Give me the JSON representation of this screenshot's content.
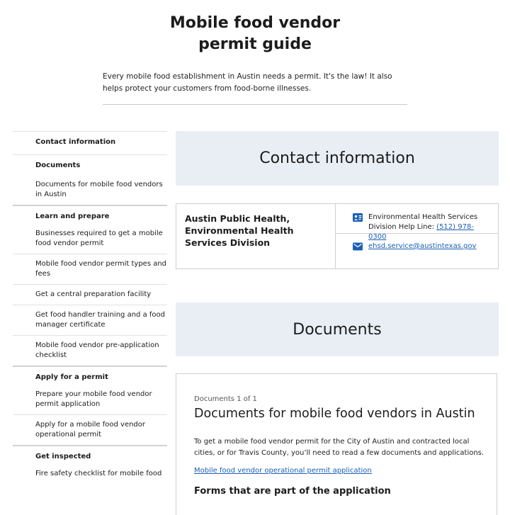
{
  "page": {
    "title": "Mobile food vendor permit guide",
    "intro": "Every mobile food establishment in Austin needs a permit. It's the law! It also helps protect your customers from food-borne illnesses."
  },
  "sidebar": {
    "items": [
      {
        "label": "Contact information",
        "section": true
      },
      {
        "label": "Documents",
        "section": true
      },
      {
        "label": "Documents for mobile food vendors in Austin",
        "section": false
      },
      {
        "label": "Learn and prepare",
        "section": true
      },
      {
        "label": "Businesses required to get a mobile food vendor permit",
        "section": false
      },
      {
        "label": "Mobile food vendor permit types and fees",
        "section": false
      },
      {
        "label": "Get a central preparation facility",
        "section": false
      },
      {
        "label": "Get food handler training and a food manager certificate",
        "section": false
      },
      {
        "label": "Mobile food vendor pre-application checklist",
        "section": false
      },
      {
        "label": "Apply for a permit",
        "section": true
      },
      {
        "label": "Prepare your mobile food vendor permit application",
        "section": false
      },
      {
        "label": "Apply for a mobile food vendor operational permit",
        "section": false
      },
      {
        "label": "Get inspected",
        "section": true
      },
      {
        "label": "Fire safety checklist for mobile food",
        "section": false
      }
    ]
  },
  "contact": {
    "heading": "Contact information",
    "org_name": "Austin Public Health, Environmental Health Services Division",
    "phone_label": "Environmental Health Services Division Help Line: ",
    "phone": "(512) 978-0300",
    "email": "ehsd.service@austintexas.gov",
    "phone_icon": "contact-card-icon",
    "email_icon": "mail-icon",
    "accent_color": "#1a5fb4"
  },
  "documents": {
    "heading": "Documents",
    "count": "Documents 1 of 1",
    "title": "Documents for mobile food vendors in Austin",
    "description": "To get a mobile food vendor permit for the City of Austin and contracted local cities, or for Travis County, you’ll need to read a few documents and applications.",
    "link": "Mobile food vendor operational permit application",
    "subheading": "Forms that are part of the application"
  }
}
